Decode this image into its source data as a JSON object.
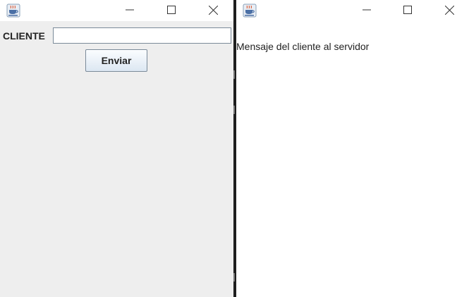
{
  "client_window": {
    "controls": {
      "minimize": "minimize",
      "maximize": "maximize",
      "close": "close"
    },
    "label": "CLIENTE",
    "input_value": "",
    "send_button_label": "Enviar"
  },
  "server_window": {
    "controls": {
      "minimize": "minimize",
      "maximize": "maximize",
      "close": "close"
    },
    "message": "Mensaje del cliente al servidor"
  },
  "icons": {
    "app": "java-coffee-cup-icon",
    "minimize": "minimize-icon",
    "maximize": "maximize-icon",
    "close": "close-icon"
  },
  "colors": {
    "client_background": "#eeeeee",
    "server_background": "#ffffff",
    "divider": "#1e1e1e",
    "button_gradient_top": "#fbfdff",
    "button_gradient_bottom": "#dce7f2"
  }
}
